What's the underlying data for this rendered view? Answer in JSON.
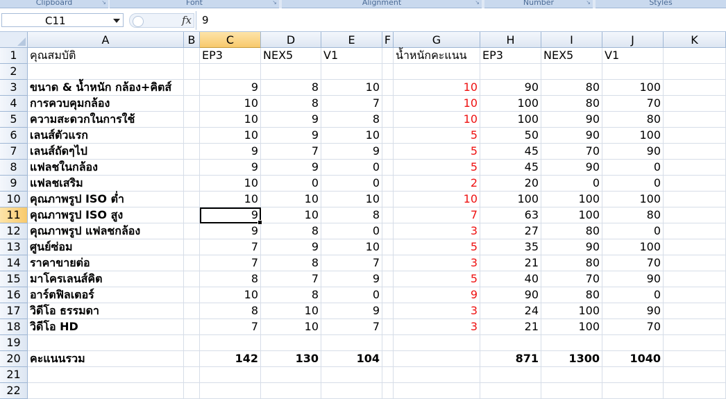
{
  "ribbon": [
    "Clipboard",
    "Font",
    "Alignment",
    "Number",
    "Styles"
  ],
  "namebox": "C11",
  "formula": "9",
  "fx_label": "fx",
  "columns": [
    "A",
    "B",
    "C",
    "D",
    "E",
    "F",
    "G",
    "H",
    "I",
    "J",
    "K"
  ],
  "selected_col": "C",
  "selected_row": 11,
  "row_numbers": [
    1,
    2,
    3,
    4,
    5,
    6,
    7,
    8,
    9,
    10,
    11,
    12,
    13,
    14,
    15,
    16,
    17,
    18,
    19,
    20,
    21,
    22
  ],
  "rows": [
    [
      "คุณสมบัติ",
      "",
      "EP3",
      "NEX5",
      "V1",
      "",
      "น้ำหนักคะแนน",
      "EP3",
      "NEX5",
      "V1",
      ""
    ],
    [
      "",
      "",
      "",
      "",
      "",
      "",
      "",
      "",
      "",
      "",
      ""
    ],
    [
      "ขนาด & น้ำหนัก กล้อง+คิตส์",
      "",
      "9",
      "8",
      "10",
      "",
      "10",
      "90",
      "80",
      "100",
      ""
    ],
    [
      "การควบคุมกล้อง",
      "",
      "10",
      "8",
      "7",
      "",
      "10",
      "100",
      "80",
      "70",
      ""
    ],
    [
      "ความสะดวกในการใช้",
      "",
      "10",
      "9",
      "8",
      "",
      "10",
      "100",
      "90",
      "80",
      ""
    ],
    [
      "เลนส์ตัวแรก",
      "",
      "10",
      "9",
      "10",
      "",
      "5",
      "50",
      "90",
      "100",
      ""
    ],
    [
      "เลนส์ถัดๆไป",
      "",
      "9",
      "7",
      "9",
      "",
      "5",
      "45",
      "70",
      "90",
      ""
    ],
    [
      "แฟลชในกล้อง",
      "",
      "9",
      "9",
      "0",
      "",
      "5",
      "45",
      "90",
      "0",
      ""
    ],
    [
      "แฟลชเสริม",
      "",
      "10",
      "0",
      "0",
      "",
      "2",
      "20",
      "0",
      "0",
      ""
    ],
    [
      "คุณภาพรูป ISO ต่ำ",
      "",
      "10",
      "10",
      "10",
      "",
      "10",
      "100",
      "100",
      "100",
      ""
    ],
    [
      "คุณภาพรูป ISO สูง",
      "",
      "9",
      "10",
      "8",
      "",
      "7",
      "63",
      "100",
      "80",
      ""
    ],
    [
      "คุณภาพรูป แฟลชกล้อง",
      "",
      "9",
      "8",
      "0",
      "",
      "3",
      "27",
      "80",
      "0",
      ""
    ],
    [
      "ศูนย์ซ่อม",
      "",
      "7",
      "9",
      "10",
      "",
      "5",
      "35",
      "90",
      "100",
      ""
    ],
    [
      "ราคาขายต่อ",
      "",
      "7",
      "8",
      "7",
      "",
      "3",
      "21",
      "80",
      "70",
      ""
    ],
    [
      "มาโครเลนส์คิต",
      "",
      "8",
      "7",
      "9",
      "",
      "5",
      "40",
      "70",
      "90",
      ""
    ],
    [
      "อาร์ตฟิลเตอร์",
      "",
      "10",
      "8",
      "0",
      "",
      "9",
      "90",
      "80",
      "0",
      ""
    ],
    [
      "วิดีโอ ธรรมดา",
      "",
      "8",
      "10",
      "9",
      "",
      "3",
      "24",
      "100",
      "90",
      ""
    ],
    [
      "วิดีโอ HD",
      "",
      "7",
      "10",
      "7",
      "",
      "3",
      "21",
      "100",
      "70",
      ""
    ],
    [
      "",
      "",
      "",
      "",
      "",
      "",
      "",
      "",
      "",
      "",
      ""
    ],
    [
      "คะแนนรวม",
      "",
      "142",
      "130",
      "104",
      "",
      "",
      "871",
      "1300",
      "1040",
      ""
    ],
    [
      "",
      "",
      "",
      "",
      "",
      "",
      "",
      "",
      "",
      "",
      ""
    ],
    [
      "",
      "",
      "",
      "",
      "",
      "",
      "",
      "",
      "",
      "",
      ""
    ]
  ]
}
